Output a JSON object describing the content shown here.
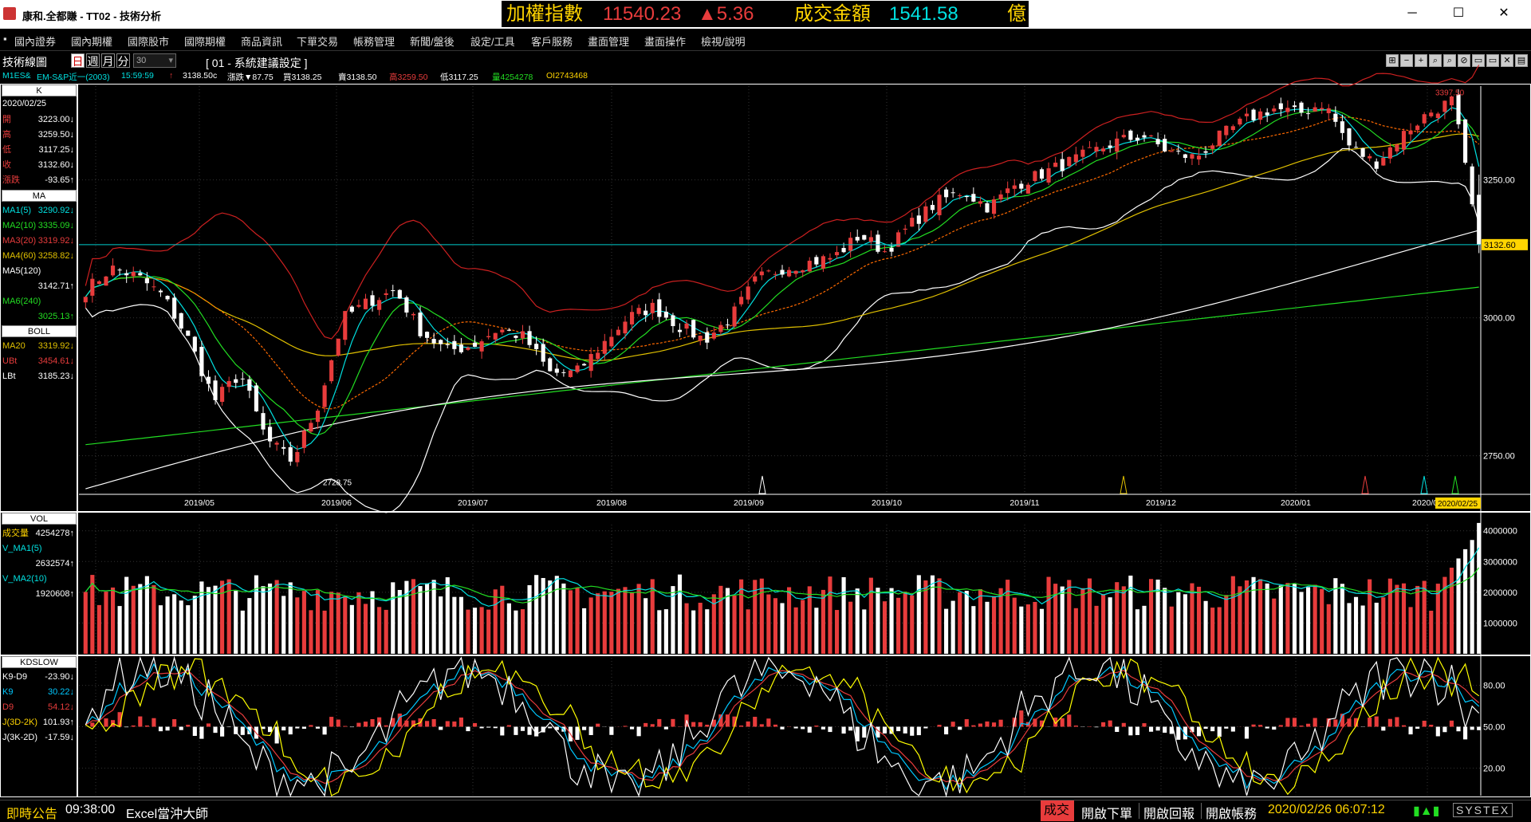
{
  "window": {
    "title": "康和.全都賺 - TT02 - 技術分析"
  },
  "ticker": {
    "index_label": "加權指數",
    "index_value": "11540.23",
    "index_change": "▲5.36",
    "turnover_label": "成交金額",
    "turnover_value": "1541.58",
    "turnover_unit": "億"
  },
  "window_controls": {
    "minimize": "─",
    "maximize": "☐",
    "close": "✕"
  },
  "menu": {
    "sys_icon": "▪",
    "items": [
      "國內證券",
      "國內期權",
      "國際股市",
      "國際期權",
      "商品資訊",
      "下單交易",
      "帳務管理",
      "新聞/盤後",
      "設定/工具",
      "客戶服務",
      "畫面管理",
      "畫面操作",
      "檢視/說明"
    ]
  },
  "chart_toolbar": {
    "title": "技術線圖",
    "periods": [
      "日",
      "週",
      "月",
      "分"
    ],
    "active_period": "日",
    "interval": "30",
    "setting": "[ 01 - 系統建議設定 ]",
    "tools": [
      "⊞",
      "−",
      "+",
      "⌕",
      "⌕",
      "⊘",
      "▭",
      "▭",
      "✕",
      "▤"
    ]
  },
  "quote": {
    "symbol": "M1ES&",
    "name": "EM-S&P近一(2003)",
    "time": "15:59:59",
    "arrow": "↑",
    "last": "3138.50c",
    "change": "漲跌▼87.75",
    "buy": "買3138.25",
    "sell": "賣3138.50",
    "high": "高3259.50",
    "low": "低3117.25",
    "volume": "量4254278",
    "oi": "OI2743468"
  },
  "left_panel": {
    "k_title": "K",
    "date": "2020/02/25",
    "ohlc": [
      {
        "k": "開",
        "v": "3223.00↓"
      },
      {
        "k": "高",
        "v": "3259.50↓"
      },
      {
        "k": "低",
        "v": "3117.25↓"
      },
      {
        "k": "收",
        "v": "3132.60↓"
      },
      {
        "k": "漲跌",
        "v": "-93.65↑"
      }
    ],
    "ma_title": "MA",
    "mas": [
      {
        "k": "MA1(5)",
        "v": "3290.92↓"
      },
      {
        "k": "MA2(10)",
        "v": "3335.09↓"
      },
      {
        "k": "MA3(20)",
        "v": "3319.92↓"
      },
      {
        "k": "MA4(60)",
        "v": "3258.82↓"
      },
      {
        "k": "MA5(120)",
        "v": ""
      },
      {
        "k": "",
        "v": "3142.71↑"
      },
      {
        "k": "MA6(240)",
        "v": ""
      },
      {
        "k": "",
        "v": "3025.13↑"
      }
    ],
    "boll_title": "BOLL",
    "boll": [
      {
        "k": "MA20",
        "v": "3319.92↓"
      },
      {
        "k": "UBt",
        "v": "3454.61↓"
      },
      {
        "k": "LBt",
        "v": "3185.23↓"
      }
    ],
    "vol_title": "VOL",
    "vol": [
      {
        "k": "成交量",
        "v": "4254278↑"
      },
      {
        "k": "V_MA1(5)",
        "v": ""
      },
      {
        "k": "",
        "v": "2632574↑"
      },
      {
        "k": "V_MA2(10)",
        "v": ""
      },
      {
        "k": "",
        "v": "1920608↑"
      }
    ],
    "kd_title": "KDSLOW",
    "kd": [
      {
        "k": "K9-D9",
        "v": "-23.90↓"
      },
      {
        "k": "K9",
        "v": "30.22↓"
      },
      {
        "k": "D9",
        "v": "54.12↓"
      },
      {
        "k": "J(3D-2K)",
        "v": "101.93↑"
      },
      {
        "k": "J(3K-2D)",
        "v": "-17.59↓"
      }
    ]
  },
  "chart_data": [
    {
      "type": "candlestick",
      "title": "",
      "price_axis": [
        "3250.00",
        "3000.00",
        "2750.00"
      ],
      "last_price_tag": "3132.60",
      "high_label": "3397.50",
      "low_label": "2728.75",
      "date_axis": [
        "2019/05",
        "2019/06",
        "2019/07",
        "2019/08",
        "2019/09",
        "2019/10",
        "2019/11",
        "2019/12",
        "2020/01",
        "2020/02"
      ],
      "current_date": "2020/02/25",
      "ylim": [
        2680,
        3420
      ],
      "close_path": [
        3050,
        3090,
        3075,
        3040,
        2960,
        2850,
        2900,
        2780,
        2740,
        2840,
        3000,
        3030,
        3050,
        2975,
        2940,
        2950,
        2980,
        2965,
        2900,
        2900,
        2950,
        3000,
        3020,
        2985,
        2960,
        3000,
        3070,
        3090,
        3100,
        3110,
        3150,
        3120,
        3170,
        3210,
        3230,
        3200,
        3240,
        3260,
        3280,
        3300,
        3320,
        3330,
        3300,
        3290,
        3330,
        3360,
        3380,
        3370,
        3390,
        3310,
        3280,
        3330,
        3370,
        3395,
        3132
      ]
    },
    {
      "type": "bar",
      "title": "",
      "axis": [
        "4000000",
        "3000000",
        "2000000",
        "1000000"
      ],
      "ylim": [
        0,
        4200000
      ],
      "last_volume": 4254278
    },
    {
      "type": "line",
      "title": "",
      "axis": [
        "80.00",
        "50.00",
        "20.00"
      ],
      "ylim": [
        0,
        100
      ]
    }
  ],
  "status": {
    "announce": "即時公告",
    "time": "09:38:00",
    "ticker_text": "Excel當沖大師",
    "trade": "成交",
    "open_order": "開啟下單",
    "open_report": "開啟回報",
    "open_account": "開啟帳務",
    "datetime": "2020/02/26 06:07:12",
    "brand": "SYSTEX"
  },
  "colors": {
    "up": "#e83c3c",
    "down": "#ffffff",
    "ma5": "#00e0e0",
    "ma10": "#22dd22",
    "ma20": "#ff6a00",
    "ma60": "#e0c000",
    "ma120": "#ffffff",
    "ma240": "#22dd22",
    "boll": "#cc2020",
    "k": "#00c8ff",
    "d": "#e83c3c",
    "j": "#ffff00"
  }
}
